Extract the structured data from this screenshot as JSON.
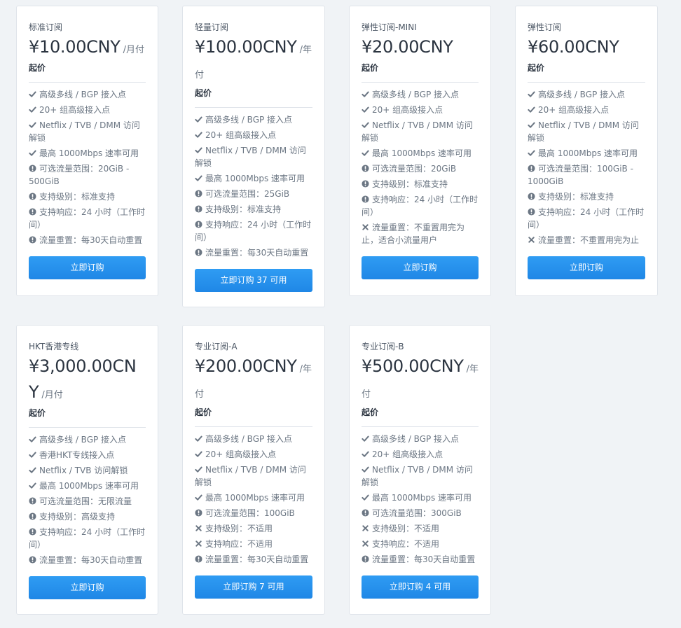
{
  "plans": [
    {
      "name": "标准订阅",
      "price": "¥10.00CNY",
      "unit": "/月付",
      "from": "起价",
      "features": [
        {
          "icon": "check",
          "text": "高级多线 / BGP 接入点"
        },
        {
          "icon": "check",
          "text": "20+ 组高级接入点"
        },
        {
          "icon": "check",
          "text": "Netflix / TVB / DMM 访问解锁"
        },
        {
          "icon": "check",
          "text": "最高 1000Mbps 速率可用"
        },
        {
          "icon": "info",
          "text": "可选流量范围：20GiB - 500GiB"
        },
        {
          "icon": "info",
          "text": "支持级别：标准支持"
        },
        {
          "icon": "info",
          "text": "支持响应：24 小时（工作时间）"
        },
        {
          "icon": "info",
          "text": "流量重置：每30天自动重置"
        }
      ],
      "button": "立即订购"
    },
    {
      "name": "轻量订阅",
      "price": "¥100.00CNY",
      "unit": "/年付",
      "from": "起价",
      "features": [
        {
          "icon": "check",
          "text": "高级多线 / BGP 接入点"
        },
        {
          "icon": "check",
          "text": "20+ 组高级接入点"
        },
        {
          "icon": "check",
          "text": "Netflix / TVB / DMM 访问解锁"
        },
        {
          "icon": "check",
          "text": "最高 1000Mbps 速率可用"
        },
        {
          "icon": "info",
          "text": "可选流量范围：25GiB"
        },
        {
          "icon": "info",
          "text": "支持级别：标准支持"
        },
        {
          "icon": "info",
          "text": "支持响应：24 小时（工作时间）"
        },
        {
          "icon": "info",
          "text": "流量重置：每30天自动重置"
        }
      ],
      "button": "立即订购 37 可用"
    },
    {
      "name": "弹性订阅-MINI",
      "price": "¥20.00CNY",
      "unit": "",
      "from": "起价",
      "features": [
        {
          "icon": "check",
          "text": "高级多线 / BGP 接入点"
        },
        {
          "icon": "check",
          "text": "20+ 组高级接入点"
        },
        {
          "icon": "check",
          "text": "Netflix / TVB / DMM 访问解锁"
        },
        {
          "icon": "check",
          "text": "最高 1000Mbps 速率可用"
        },
        {
          "icon": "info",
          "text": "可选流量范围：20GiB"
        },
        {
          "icon": "info",
          "text": "支持级别：标准支持"
        },
        {
          "icon": "info",
          "text": "支持响应：24 小时（工作时间）"
        },
        {
          "icon": "cross",
          "text": "流量重置：不重置用完为止，适合小流量用户"
        }
      ],
      "button": "立即订购"
    },
    {
      "name": "弹性订阅",
      "price": "¥60.00CNY",
      "unit": "",
      "from": "起价",
      "features": [
        {
          "icon": "check",
          "text": "高级多线 / BGP 接入点"
        },
        {
          "icon": "check",
          "text": "20+ 组高级接入点"
        },
        {
          "icon": "check",
          "text": "Netflix / TVB / DMM 访问解锁"
        },
        {
          "icon": "check",
          "text": "最高 1000Mbps 速率可用"
        },
        {
          "icon": "info",
          "text": "可选流量范围：100GiB - 1000GiB"
        },
        {
          "icon": "info",
          "text": "支持级别：标准支持"
        },
        {
          "icon": "info",
          "text": "支持响应：24 小时（工作时间）"
        },
        {
          "icon": "cross",
          "text": "流量重置：不重置用完为止"
        }
      ],
      "button": "立即订购"
    },
    {
      "name": "HKT香港专线",
      "price": "¥3,000.00CNY",
      "unit": "/月付",
      "from": "起价",
      "features": [
        {
          "icon": "check",
          "text": "高级多线 / BGP 接入点"
        },
        {
          "icon": "check",
          "text": "香港HKT专线接入点"
        },
        {
          "icon": "check",
          "text": "Netflix / TVB 访问解锁"
        },
        {
          "icon": "check",
          "text": "最高 1000Mbps 速率可用"
        },
        {
          "icon": "info",
          "text": "可选流量范围：无限流量"
        },
        {
          "icon": "info",
          "text": "支持级别：高级支持"
        },
        {
          "icon": "info",
          "text": "支持响应：24 小时（工作时间）"
        },
        {
          "icon": "info",
          "text": "流量重置：每30天自动重置"
        }
      ],
      "button": "立即订购"
    },
    {
      "name": "专业订阅-A",
      "price": "¥200.00CNY",
      "unit": "/年付",
      "from": "起价",
      "features": [
        {
          "icon": "check",
          "text": "高级多线 / BGP 接入点"
        },
        {
          "icon": "check",
          "text": "20+ 组高级接入点"
        },
        {
          "icon": "check",
          "text": "Netflix / TVB / DMM 访问解锁"
        },
        {
          "icon": "check",
          "text": "最高 1000Mbps 速率可用"
        },
        {
          "icon": "info",
          "text": "可选流量范围：100GiB"
        },
        {
          "icon": "cross",
          "text": "支持级别：不适用"
        },
        {
          "icon": "cross",
          "text": "支持响应：不适用"
        },
        {
          "icon": "info",
          "text": "流量重置：每30天自动重置"
        }
      ],
      "button": "立即订购 7 可用"
    },
    {
      "name": "专业订阅-B",
      "price": "¥500.00CNY",
      "unit": "/年付",
      "from": "起价",
      "features": [
        {
          "icon": "check",
          "text": "高级多线 / BGP 接入点"
        },
        {
          "icon": "check",
          "text": "20+ 组高级接入点"
        },
        {
          "icon": "check",
          "text": "Netflix / TVB / DMM 访问解锁"
        },
        {
          "icon": "check",
          "text": "最高 1000Mbps 速率可用"
        },
        {
          "icon": "info",
          "text": "可选流量范围：300GiB"
        },
        {
          "icon": "cross",
          "text": "支持级别：不适用"
        },
        {
          "icon": "cross",
          "text": "支持响应：不适用"
        },
        {
          "icon": "info",
          "text": "流量重置：每30天自动重置"
        }
      ],
      "button": "立即订购 4 可用"
    }
  ],
  "colors": {
    "page_bg": "#f0f3f6",
    "card_bg": "#ffffff",
    "button": "#2392ee",
    "icon": "#6b7683"
  }
}
